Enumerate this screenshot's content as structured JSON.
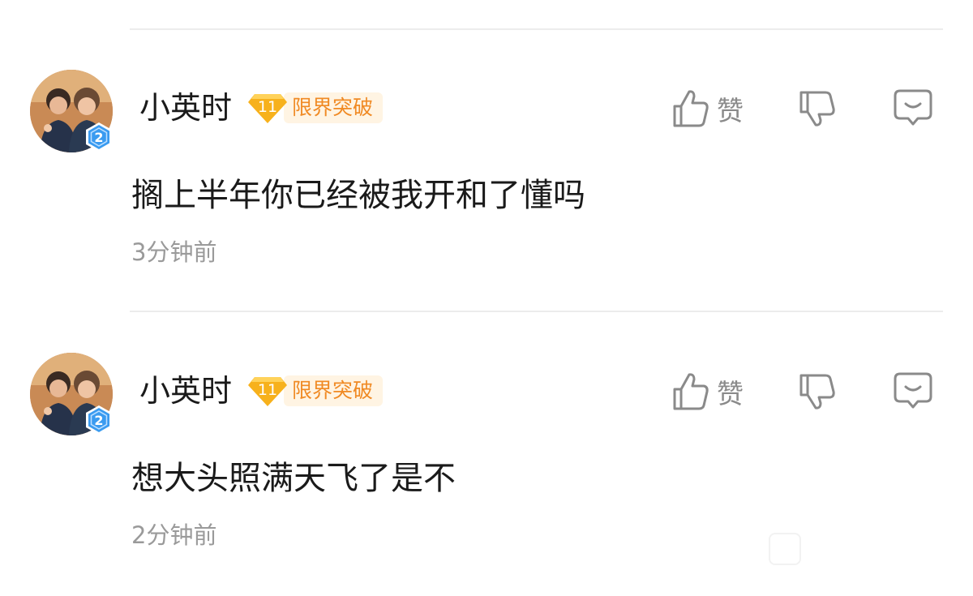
{
  "comments": [
    {
      "username": "小英时",
      "level": "11",
      "badge_text": "限界突破",
      "avatar_badge": "2",
      "like_label": "赞",
      "content": "搁上半年你已经被我开和了懂吗",
      "time": "3分钟前",
      "icons": {
        "like": "thumbs-up-icon",
        "dislike": "thumbs-down-icon",
        "reply": "comment-bubble-icon"
      }
    },
    {
      "username": "小英时",
      "level": "11",
      "badge_text": "限界突破",
      "avatar_badge": "2",
      "like_label": "赞",
      "content": "想大头照满天飞了是不",
      "time": "2分钟前",
      "icons": {
        "like": "thumbs-up-icon",
        "dislike": "thumbs-down-icon",
        "reply": "comment-bubble-icon"
      }
    }
  ],
  "colors": {
    "badge_text": "#f08a24",
    "badge_bg": "#fff4e3",
    "level_gold": "#f7b11c",
    "avatar_badge_blue": "#3a9bf0",
    "icon_gray": "#8a8a8a"
  }
}
